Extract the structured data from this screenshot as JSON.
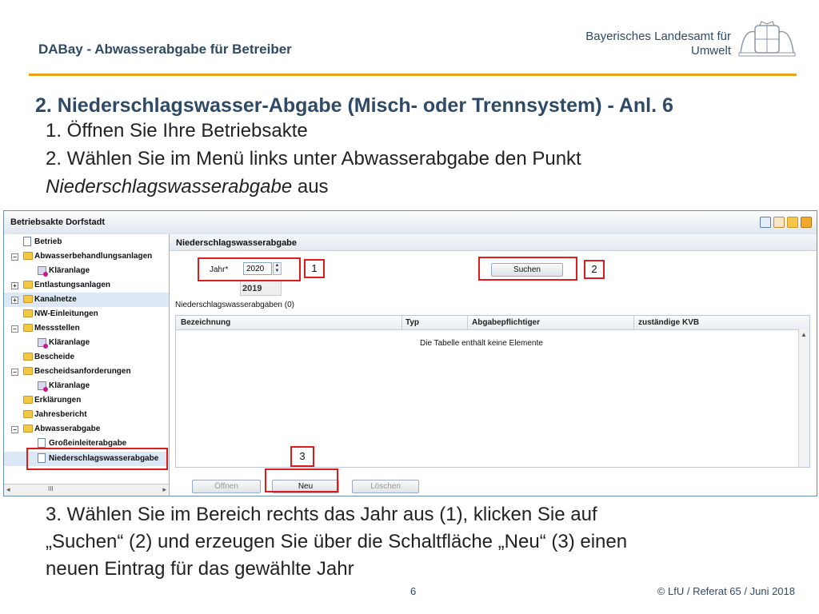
{
  "header": {
    "title": "DABay - Abwasserabgabe für Betreiber",
    "org_line1": "Bayerisches Landesamt für",
    "org_line2": "Umwelt",
    "accent_color": "#e8a317"
  },
  "slide": {
    "heading": "2. Niederschlagswasser-Abgabe (Misch- oder Trennsystem) - Anl. 6",
    "step1": "1. Öffnen Sie Ihre Betriebsakte",
    "step2": "2. Wählen Sie im Menü links unter Abwasserabgabe den Punkt",
    "step2_italic": "Niederschlagswasserabgabe",
    "step2_suffix": " aus",
    "step3_line1": "3. Wählen Sie im Bereich rechts das Jahr aus (1), klicken Sie auf",
    "step3_line2": "„Suchen“ (2) und erzeugen Sie über die Schaltfläche „Neu“ (3) einen",
    "step3_line3": "neuen Eintrag für das gewählte Jahr"
  },
  "app": {
    "window_title": "Betriebsakte Dorfstadt",
    "tree": [
      {
        "label": "Betrieb",
        "icon": "document-icon"
      },
      {
        "label": "Abwasserbehandlungsanlagen",
        "icon": "folder-icon",
        "expanded": true
      },
      {
        "label": "Kläranlage",
        "icon": "plant-icon"
      },
      {
        "label": "Entlastungsanlagen",
        "icon": "folder-icon",
        "expanded": false
      },
      {
        "label": "Kanalnetze",
        "icon": "folder-icon",
        "expanded": false
      },
      {
        "label": "NW-Einleitungen",
        "icon": "folder-icon"
      },
      {
        "label": "Messstellen",
        "icon": "folder-icon",
        "expanded": true
      },
      {
        "label": "Kläranlage",
        "icon": "plant-icon"
      },
      {
        "label": "Bescheide",
        "icon": "folder-icon"
      },
      {
        "label": "Bescheidsanforderungen",
        "icon": "folder-icon",
        "expanded": true
      },
      {
        "label": "Kläranlage",
        "icon": "plant-icon"
      },
      {
        "label": "Erklärungen",
        "icon": "folder-icon"
      },
      {
        "label": "Jahresbericht",
        "icon": "folder-icon"
      },
      {
        "label": "Abwasserabgabe",
        "icon": "folder-icon",
        "expanded": true
      },
      {
        "label": "Großeinleiterabgabe",
        "icon": "document-icon"
      },
      {
        "label": "Niederschlagswasserabgabe",
        "icon": "document-icon",
        "selected": true
      }
    ],
    "tree_scroll_mark": "III",
    "panel_title": "Niederschlagswasserabgabe",
    "year_label": "Jahr*",
    "year_value": "2020",
    "year_tip": "2019",
    "search_button": "Suchen",
    "table_caption": "Niederschlagswasserabgaben (0)",
    "columns": [
      "Bezeichnung",
      "Typ",
      "Abgabepflichtiger",
      "zuständige KVB"
    ],
    "empty_message": "Die Tabelle enthält keine Elemente",
    "btn_open": "Öffnen",
    "btn_new": "Neu",
    "btn_delete": "Löschen"
  },
  "callouts": {
    "one": "1",
    "two": "2",
    "three": "3",
    "color": "#e01b1b"
  },
  "footer": {
    "page": "6",
    "copyright": "© LfU / Referat 65 / Juni 2018"
  }
}
